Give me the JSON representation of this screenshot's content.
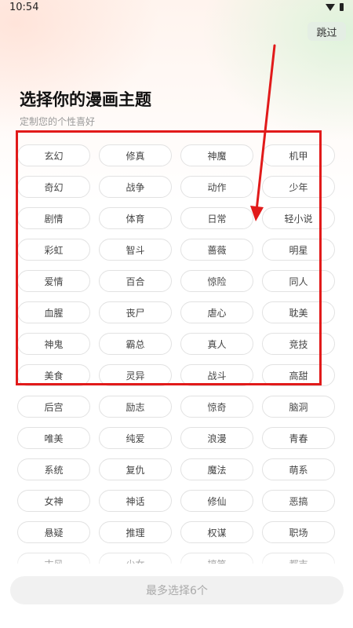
{
  "status_bar": {
    "time": "10:54"
  },
  "header": {
    "skip_label": "跳过",
    "title": "选择你的漫画主题",
    "subtitle": "定制您的个性喜好"
  },
  "themes": [
    "玄幻",
    "修真",
    "神魔",
    "机甲",
    "奇幻",
    "战争",
    "动作",
    "少年",
    "剧情",
    "体育",
    "日常",
    "轻小说",
    "彩虹",
    "智斗",
    "蔷薇",
    "明星",
    "爱情",
    "百合",
    "惊险",
    "同人",
    "血腥",
    "丧尸",
    "虐心",
    "耽美",
    "神鬼",
    "霸总",
    "真人",
    "竞技",
    "美食",
    "灵异",
    "战斗",
    "高甜",
    "后宫",
    "励志",
    "惊奇",
    "脑洞",
    "唯美",
    "纯爱",
    "浪漫",
    "青春",
    "系统",
    "复仇",
    "魔法",
    "萌系",
    "女神",
    "神话",
    "修仙",
    "恶搞",
    "悬疑",
    "推理",
    "权谋",
    "职场",
    "古风",
    "少女",
    "搞笑",
    "都市"
  ],
  "footer": {
    "confirm_label": "最多选择6个"
  },
  "colors": {
    "annotation": "#e11a1a",
    "chip_border": "#e2e2e2",
    "button_disabled_bg": "#f1f1f1",
    "skip_bg": "#e4eee4"
  },
  "icons": {
    "wifi": "wifi-icon",
    "battery": "battery-icon"
  }
}
